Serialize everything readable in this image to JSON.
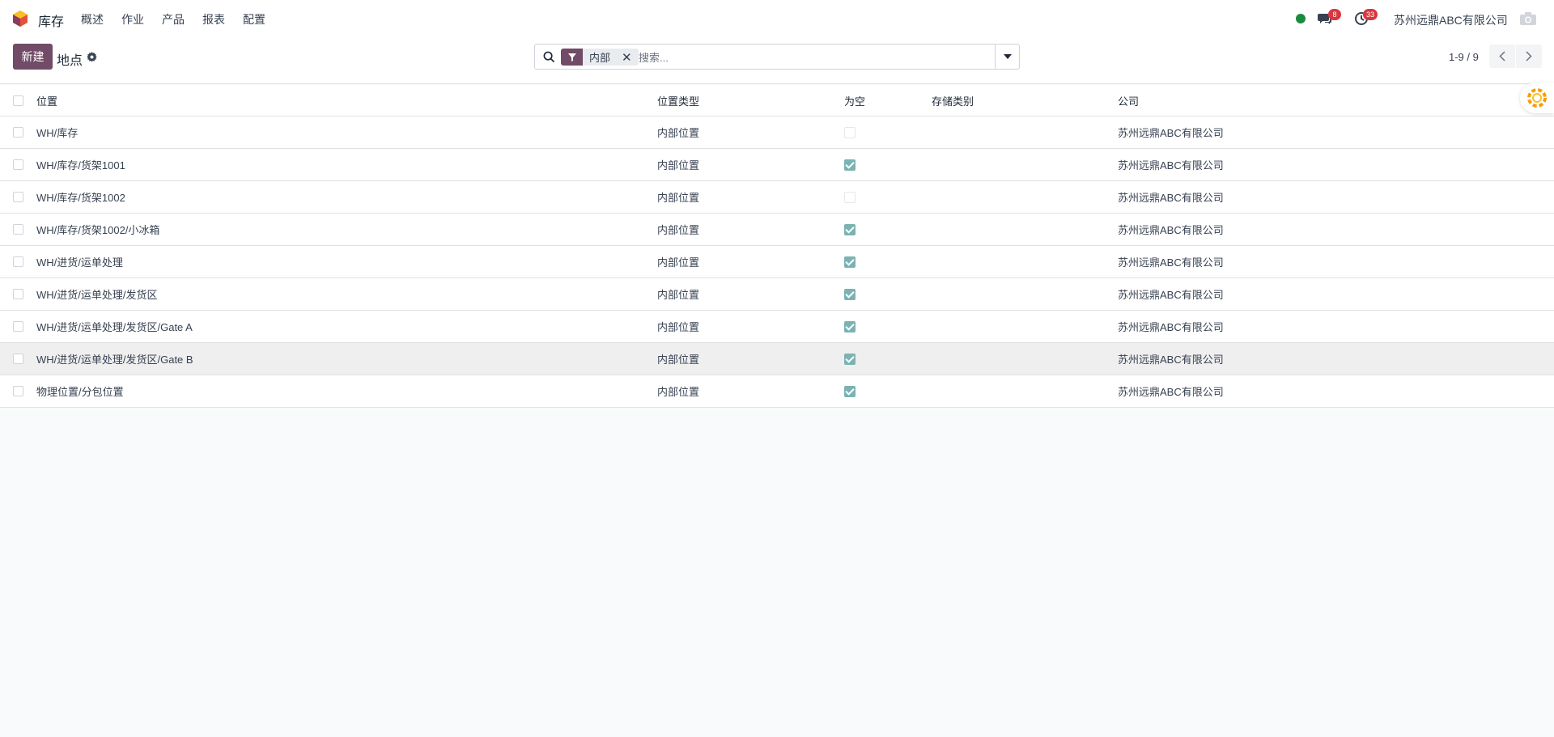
{
  "navbar": {
    "app_name": "库存",
    "menu": [
      "概述",
      "作业",
      "产品",
      "报表",
      "配置"
    ],
    "messages_badge": "8",
    "activities_badge": "33",
    "company": "苏州远鼎ABC有限公司"
  },
  "control": {
    "new_label": "新建",
    "title": "地点",
    "facet_value": "内部",
    "search_placeholder": "搜索...",
    "pager": "1-9 / 9"
  },
  "list": {
    "columns": [
      "位置",
      "位置类型",
      "为空",
      "存储类别",
      "公司"
    ],
    "rows": [
      {
        "name": "WH/库存",
        "type": "内部位置",
        "empty": false,
        "storage": "",
        "company": "苏州远鼎ABC有限公司"
      },
      {
        "name": "WH/库存/货架1001",
        "type": "内部位置",
        "empty": true,
        "storage": "",
        "company": "苏州远鼎ABC有限公司"
      },
      {
        "name": "WH/库存/货架1002",
        "type": "内部位置",
        "empty": false,
        "storage": "",
        "company": "苏州远鼎ABC有限公司"
      },
      {
        "name": "WH/库存/货架1002/小冰箱",
        "type": "内部位置",
        "empty": true,
        "storage": "",
        "company": "苏州远鼎ABC有限公司"
      },
      {
        "name": "WH/进货/运单处理",
        "type": "内部位置",
        "empty": true,
        "storage": "",
        "company": "苏州远鼎ABC有限公司"
      },
      {
        "name": "WH/进货/运单处理/发货区",
        "type": "内部位置",
        "empty": true,
        "storage": "",
        "company": "苏州远鼎ABC有限公司"
      },
      {
        "name": "WH/进货/运单处理/发货区/Gate A",
        "type": "内部位置",
        "empty": true,
        "storage": "",
        "company": "苏州远鼎ABC有限公司"
      },
      {
        "name": "WH/进货/运单处理/发货区/Gate B",
        "type": "内部位置",
        "empty": true,
        "storage": "",
        "company": "苏州远鼎ABC有限公司"
      },
      {
        "name": "物理位置/分包位置",
        "type": "内部位置",
        "empty": true,
        "storage": "",
        "company": "苏州远鼎ABC有限公司"
      }
    ]
  },
  "colors": {
    "brand": "#714b67",
    "check": "#7bb3b3",
    "badge": "#d9363e",
    "status": "#1a8a3c"
  }
}
